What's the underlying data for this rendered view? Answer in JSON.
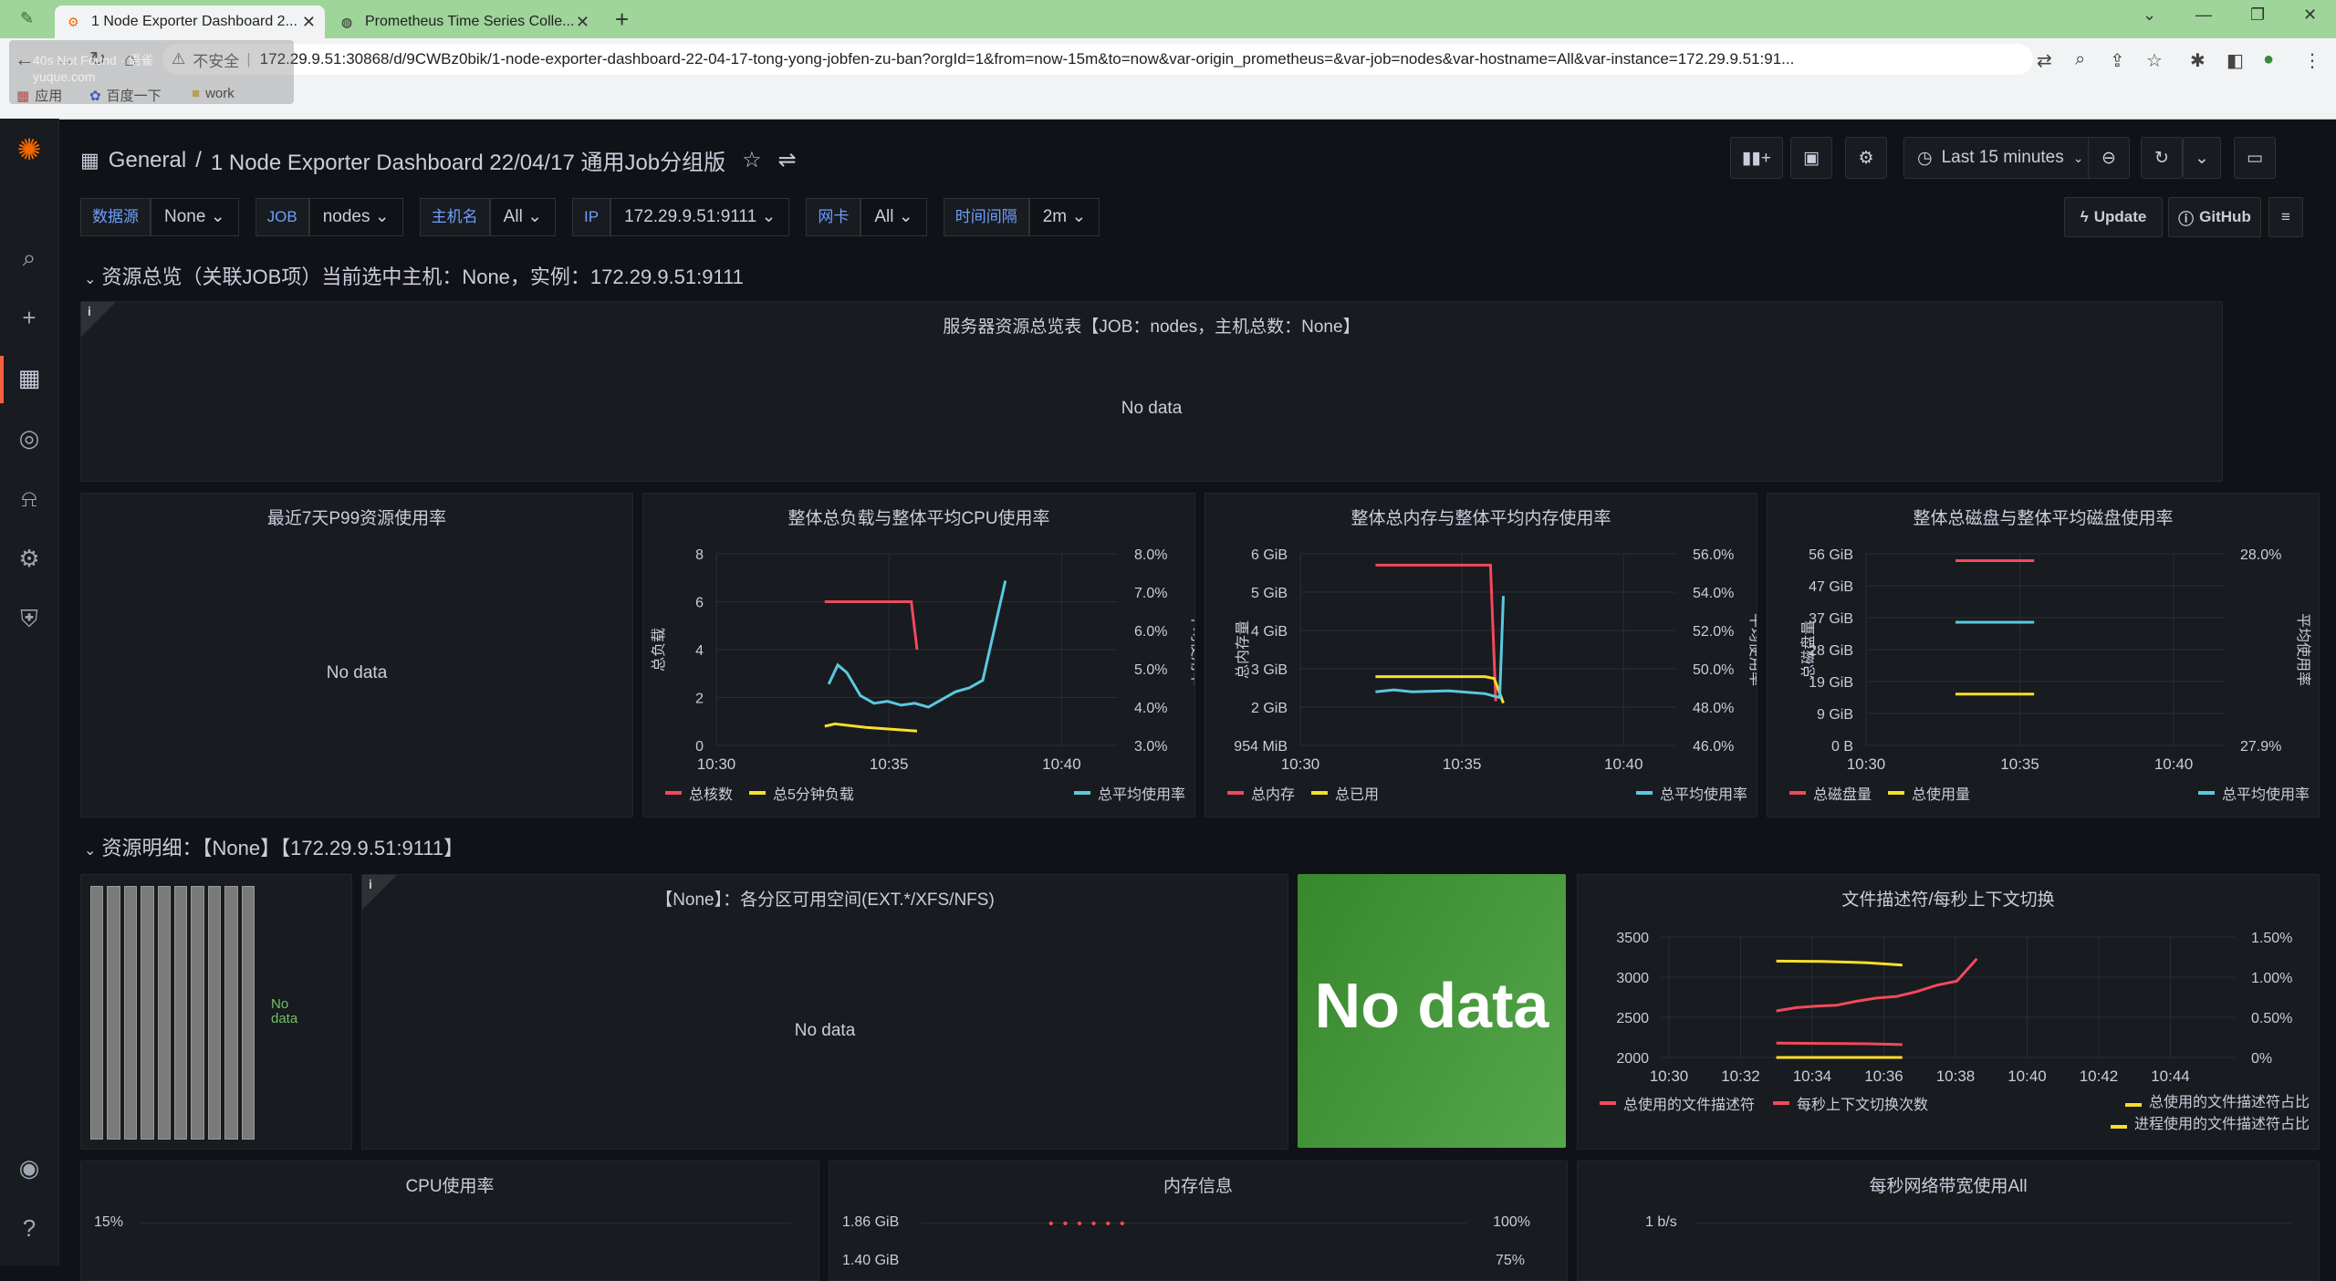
{
  "browser": {
    "tabs": [
      {
        "label": "1 Node Exporter Dashboard 2...",
        "active": true
      },
      {
        "label": "Prometheus Time Series Colle..."
      }
    ],
    "url_prefix": "不安全",
    "url": "172.29.9.51:30868/d/9CWBz0bik/1-node-exporter-dashboard-22-04-17-tong-yong-jobfen-zu-ban?orgId=1&from=now-15m&to=now&var-origin_prometheus=&var-job=nodes&var-hostname=All&var-instance=172.29.9.51:91...",
    "ghost_text": "40s Not Found · 语雀  yuque.com",
    "bookmarks": [
      "应用",
      "百度一下",
      "work"
    ]
  },
  "header": {
    "breadcrumb_root": "General",
    "breadcrumb_sep": "/",
    "title": "1 Node Exporter Dashboard 22/04/17 通用Job分组版",
    "time_range": "Last 15 minutes",
    "update_label": "Update",
    "github_label": "GitHub"
  },
  "variables": [
    {
      "label": "数据源",
      "value": "None"
    },
    {
      "label": "JOB",
      "value": "nodes"
    },
    {
      "label": "主机名",
      "value": "All"
    },
    {
      "label": "IP",
      "value": "172.29.9.51:9111"
    },
    {
      "label": "网卡",
      "value": "All"
    },
    {
      "label": "时间间隔",
      "value": "2m"
    }
  ],
  "rows": {
    "overview": "资源总览（关联JOB项）当前选中主机：None，实例：172.29.9.51:9111",
    "detail": "资源明细：【None】【172.29.9.51:9111】"
  },
  "panels": {
    "summary_table": {
      "title": "服务器资源总览表【JOB：nodes，主机总数：None】",
      "nodata": "No data"
    },
    "p99": {
      "title": "最近7天P99资源使用率",
      "nodata": "No data"
    },
    "cpu_load": {
      "title": "整体总负载与整体平均CPU使用率",
      "y_left_label": "总负载",
      "y_right_label": "平均使用率",
      "legend": [
        "总核数",
        "总5分钟负载",
        "总平均使用率"
      ]
    },
    "mem": {
      "title": "整体总内存与整体平均内存使用率",
      "y_left_label": "总内存量",
      "y_right_label": "平均使用率",
      "legend": [
        "总内存",
        "总已用",
        "总平均使用率"
      ]
    },
    "disk": {
      "title": "整体总磁盘与整体平均磁盘使用率",
      "y_left_label": "总磁盘量",
      "y_right_label": "平均使用率",
      "legend": [
        "总磁盘量",
        "总使用量",
        "总平均使用率"
      ]
    },
    "gauge_nodata": "No\ndata",
    "partition": {
      "title": "【None】：各分区可用空间(EXT.*/XFS/NFS)",
      "nodata": "No data"
    },
    "big_stat": {
      "nodata": "No data"
    },
    "fd": {
      "title": "文件描述符/每秒上下文切换",
      "legend": [
        "总使用的文件描述符",
        "每秒上下文切换次数",
        "总使用的文件描述符占比",
        "进程使用的文件描述符占比"
      ]
    },
    "cpu_usage": {
      "title": "CPU使用率",
      "tick": "15%"
    },
    "mem_info": {
      "title": "内存信息",
      "ticks": [
        "1.86 GiB",
        "1.40 GiB"
      ],
      "rticks": [
        "100%",
        "75%"
      ]
    },
    "net": {
      "title": "每秒网络带宽使用All",
      "tick": "1 b/s"
    }
  },
  "chart_data": [
    {
      "type": "line",
      "title": "整体总负载与整体平均CPU使用率",
      "x_ticks": [
        "10:30",
        "10:35",
        "10:40"
      ],
      "y_left_ticks": [
        "0",
        "2",
        "4",
        "6",
        "8"
      ],
      "y_right_ticks": [
        "3.0%",
        "4.0%",
        "5.0%",
        "6.0%",
        "7.0%",
        "8.0%"
      ],
      "series": [
        {
          "name": "总核数",
          "color": "#f2495c",
          "axis": "left",
          "x": [
            0,
            45,
            48
          ],
          "y": [
            6,
            6,
            4
          ]
        },
        {
          "name": "总5分钟负载",
          "color": "#fade2a",
          "axis": "left",
          "x": [
            0,
            5,
            20,
            45
          ],
          "y": [
            0.8,
            0.9,
            0.75,
            0.6
          ]
        },
        {
          "name": "总平均使用率",
          "color": "#5bc8e0",
          "axis": "right",
          "x": [
            2,
            6,
            10,
            16,
            22,
            28,
            34,
            40,
            46,
            52,
            58,
            64,
            70,
            75,
            80
          ],
          "y": [
            4.6,
            5.1,
            4.9,
            4.3,
            4.1,
            4.15,
            4.05,
            4.1,
            4.0,
            4.2,
            4.4,
            4.5,
            4.7,
            6.0,
            7.3
          ]
        }
      ]
    },
    {
      "type": "line",
      "title": "整体总内存与整体平均内存使用率",
      "x_ticks": [
        "10:30",
        "10:35",
        "10:40"
      ],
      "y_left_ticks": [
        "954 MiB",
        "2 GiB",
        "3 GiB",
        "4 GiB",
        "5 GiB",
        "6 GiB"
      ],
      "y_right_ticks": [
        "46.0%",
        "48.0%",
        "50.0%",
        "52.0%",
        "54.0%",
        "56.0%"
      ],
      "series": [
        {
          "name": "总内存",
          "color": "#f2495c",
          "axis": "left",
          "x": [
            0,
            65,
            68
          ],
          "y": [
            5.7,
            5.7,
            2.1
          ]
        },
        {
          "name": "总已用",
          "color": "#fade2a",
          "axis": "left",
          "x": [
            0,
            60,
            65,
            70
          ],
          "y": [
            2.75,
            2.75,
            2.7,
            2.05
          ]
        },
        {
          "name": "总平均使用率",
          "color": "#5bc8e0",
          "axis": "right",
          "x": [
            0,
            10,
            20,
            40,
            60,
            64,
            68,
            70
          ],
          "y": [
            48.8,
            48.9,
            48.8,
            48.85,
            48.7,
            48.6,
            48.5,
            53.8
          ]
        }
      ]
    },
    {
      "type": "line",
      "title": "整体总磁盘与整体平均磁盘使用率",
      "x_ticks": [
        "10:30",
        "10:35",
        "10:40"
      ],
      "y_left_ticks": [
        "0 B",
        "9 GiB",
        "19 GiB",
        "28 GiB",
        "37 GiB",
        "47 GiB",
        "56 GiB"
      ],
      "y_right_ticks": [
        "27.9%",
        "28.0%"
      ],
      "series": [
        {
          "name": "总磁盘量",
          "color": "#f2495c",
          "axis": "left",
          "x": [
            0,
            100
          ],
          "y": [
            54,
            54
          ]
        },
        {
          "name": "总平均使用率",
          "color": "#5bc8e0",
          "axis": "left",
          "x": [
            0,
            100
          ],
          "y": [
            36,
            36
          ]
        },
        {
          "name": "总使用量",
          "color": "#fade2a",
          "axis": "left",
          "x": [
            0,
            100
          ],
          "y": [
            15,
            15
          ]
        }
      ]
    },
    {
      "type": "line",
      "title": "文件描述符/每秒上下文切换",
      "x_ticks": [
        "10:30",
        "10:32",
        "10:34",
        "10:36",
        "10:38",
        "10:40",
        "10:42",
        "10:44"
      ],
      "y_left_ticks": [
        "2000",
        "2500",
        "3000",
        "3500"
      ],
      "y_right_ticks": [
        "0%",
        "0.50%",
        "1.00%",
        "1.50%"
      ],
      "series": [
        {
          "name": "总使用的文件描述符",
          "color": "#f2495c",
          "x": [
            0,
            20,
            40,
            55
          ],
          "y": [
            2180,
            2175,
            2170,
            2160
          ]
        },
        {
          "name": "每秒上下文切换次数",
          "color": "#f2495c",
          "x": [
            0,
            10,
            20,
            30,
            40,
            50,
            60,
            70,
            80,
            90,
            100
          ],
          "y": [
            2580,
            2620,
            2640,
            2650,
            2700,
            2740,
            2760,
            2820,
            2900,
            2950,
            3230
          ]
        },
        {
          "name": "总使用的文件描述符占比",
          "color": "#fade2a",
          "x": [
            0,
            20,
            40,
            55
          ],
          "y": [
            3200,
            3195,
            3180,
            3150
          ]
        },
        {
          "name": "进程使用的文件描述符占比",
          "color": "#fade2a",
          "x": [
            0,
            20,
            40,
            55
          ],
          "y": [
            2000,
            2000,
            2000,
            2000
          ]
        }
      ]
    }
  ]
}
